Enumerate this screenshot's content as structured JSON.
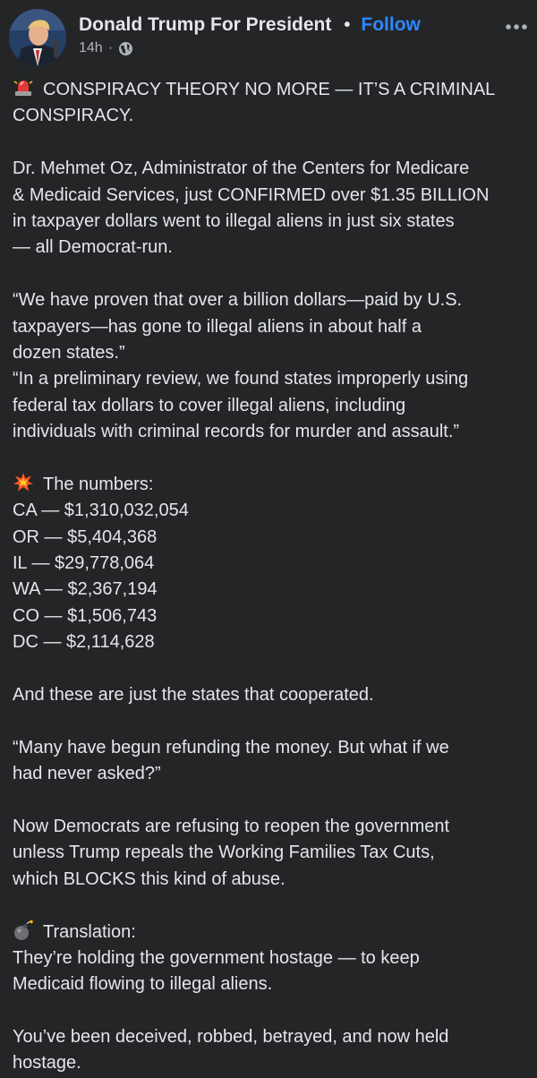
{
  "post": {
    "author": "Donald Trump For President",
    "separator": "•",
    "follow_label": "Follow",
    "timestamp": "14h",
    "meta_separator": "·",
    "privacy_icon": "globe-icon",
    "more_icon": "more-options-icon"
  },
  "body": {
    "p1": [
      "CONSPIRACY THEORY NO MORE — IT’S A CRIMINAL",
      "CONSPIRACY."
    ],
    "p2": [
      "Dr. Mehmet Oz, Administrator of the Centers for Medicare",
      "& Medicaid Services, just CONFIRMED over $1.35 BILLION",
      "in taxpayer dollars went to illegal aliens in just six states",
      "— all Democrat-run."
    ],
    "p3": [
      "“We have proven that over a billion dollars—paid by U.S.",
      "taxpayers—has gone to illegal aliens in about half a",
      "dozen states.”",
      "“In a preliminary review, we found states improperly using",
      "federal tax dollars to cover illegal aliens, including",
      "individuals with criminal records for murder and assault.”"
    ],
    "numbers_heading": "The numbers:",
    "numbers": [
      "CA — $1,310,032,054",
      "OR — $5,404,368",
      "IL — $29,778,064",
      "WA — $2,367,194",
      "CO — $1,506,743",
      "DC — $2,114,628"
    ],
    "p5": [
      "And these are just the states that cooperated."
    ],
    "p6": [
      "“Many have begun refunding the money. But what if we",
      "had never asked?”"
    ],
    "p7": [
      "Now Democrats are refusing to reopen the government",
      "unless Trump repeals the Working Families Tax Cuts,",
      "which BLOCKS this kind of abuse."
    ],
    "translation_heading": "Translation:",
    "p8": [
      "They’re holding the government hostage — to keep",
      "Medicaid flowing to illegal aliens."
    ],
    "p9": [
      "You’ve been deceived, robbed, betrayed, and now held",
      "hostage."
    ],
    "emoji_icons": [
      "siren-icon",
      "collision-icon",
      "bomb-icon"
    ]
  }
}
